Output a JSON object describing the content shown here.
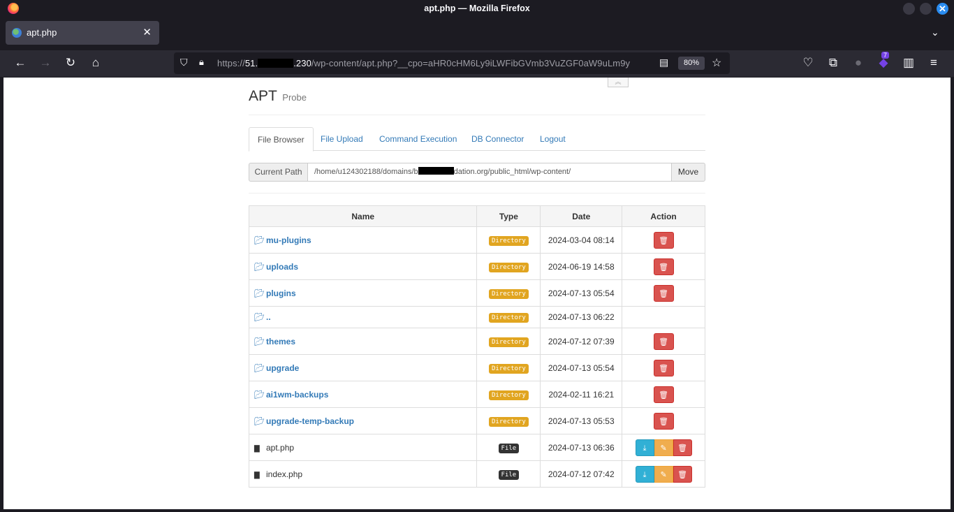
{
  "window": {
    "title": "apt.php — Mozilla Firefox"
  },
  "tab": {
    "title": "apt.php"
  },
  "urlbar": {
    "url_prefix": "https://",
    "host_start": "51.",
    "host_end": ".230",
    "path": "/wp-content/apt.php?__cpo=aHR0cHM6Ly9iLWFibGVmb3VuZGF0aW9uLm9y",
    "zoom": "80%"
  },
  "toolbar": {
    "extension_badge": "7"
  },
  "page": {
    "brand": "APT",
    "brand_sub": "Probe",
    "tabs": [
      "File Browser",
      "File Upload",
      "Command Execution",
      "DB Connector",
      "Logout"
    ],
    "active_tab": "File Browser",
    "path": {
      "label": "Current Path",
      "value_start": "/home/u124302188/domains/b",
      "value_end": "dation.org/public_html/wp-content/",
      "button": "Move"
    },
    "table": {
      "headers": [
        "Name",
        "Type",
        "Date",
        "Action"
      ],
      "rows": [
        {
          "name": "mu-plugins",
          "type": "Directory",
          "date": "2024-03-04 08:14"
        },
        {
          "name": "uploads",
          "type": "Directory",
          "date": "2024-06-19 14:58"
        },
        {
          "name": "plugins",
          "type": "Directory",
          "date": "2024-07-13 05:54"
        },
        {
          "name": "..",
          "type": "Directory",
          "date": "2024-07-13 06:22"
        },
        {
          "name": "themes",
          "type": "Directory",
          "date": "2024-07-12 07:39"
        },
        {
          "name": "upgrade",
          "type": "Directory",
          "date": "2024-07-13 05:54"
        },
        {
          "name": "ai1wm-backups",
          "type": "Directory",
          "date": "2024-02-11 16:21"
        },
        {
          "name": "upgrade-temp-backup",
          "type": "Directory",
          "date": "2024-07-13 05:53"
        },
        {
          "name": "apt.php",
          "type": "File",
          "date": "2024-07-13 06:36"
        },
        {
          "name": "index.php",
          "type": "File",
          "date": "2024-07-12 07:42"
        }
      ]
    }
  }
}
